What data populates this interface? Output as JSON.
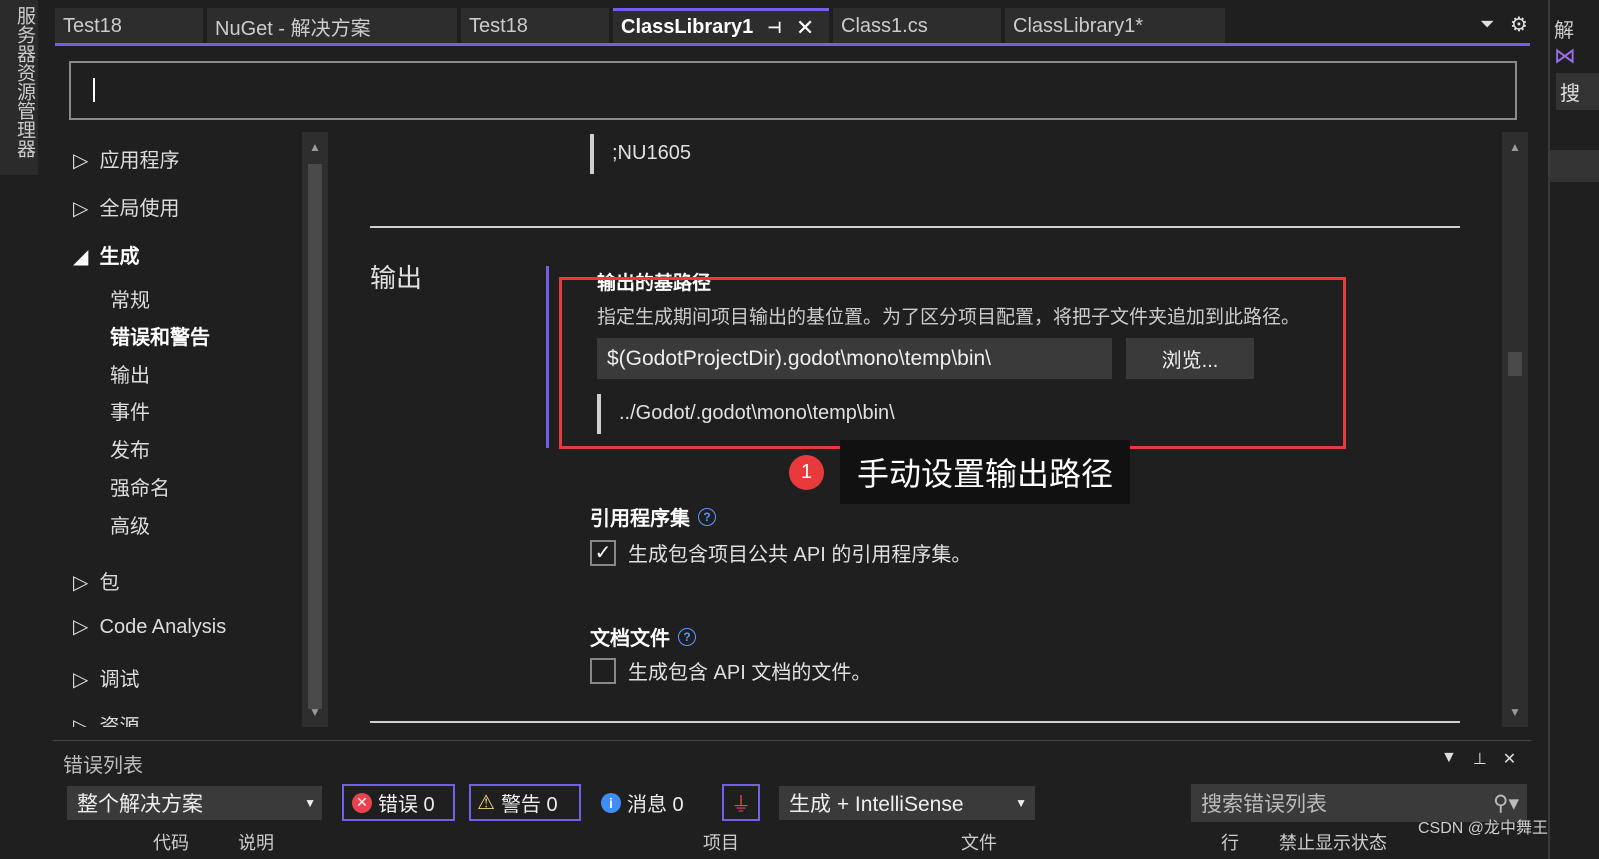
{
  "side_tab": "服务器资源管理器",
  "right_panel": {
    "title": "解",
    "search": "搜"
  },
  "tabs": [
    {
      "label": "Test18"
    },
    {
      "label": "NuGet - 解决方案"
    },
    {
      "label": "Test18"
    },
    {
      "label": "ClassLibrary1",
      "active": true
    },
    {
      "label": "Class1.cs"
    },
    {
      "label": "ClassLibrary1*"
    }
  ],
  "tab_icons": {
    "pin": "pin-icon",
    "close": "close-icon"
  },
  "search": {
    "value": ""
  },
  "nav": {
    "items": [
      {
        "label": "应用程序",
        "level": 0,
        "expanded": false
      },
      {
        "label": "全局使用",
        "level": 0,
        "expanded": false
      },
      {
        "label": "生成",
        "level": 0,
        "expanded": true
      },
      {
        "label": "常规",
        "level": 1
      },
      {
        "label": "错误和警告",
        "level": 1,
        "selected": true
      },
      {
        "label": "输出",
        "level": 1
      },
      {
        "label": "事件",
        "level": 1
      },
      {
        "label": "发布",
        "level": 1
      },
      {
        "label": "强命名",
        "level": 1
      },
      {
        "label": "高级",
        "level": 1
      },
      {
        "label": "包",
        "level": 0,
        "expanded": false
      },
      {
        "label": "Code Analysis",
        "level": 0,
        "expanded": false
      },
      {
        "label": "调试",
        "level": 0,
        "expanded": false
      },
      {
        "label": "资源",
        "level": 0,
        "expanded": false
      }
    ]
  },
  "main": {
    "prev_value": ";NU1605",
    "section_title": "输出",
    "base_path": {
      "label": "输出的基路径",
      "description": "指定生成期间项目输出的基位置。为了区分项目配置，将把子文件夹追加到此路径。",
      "value": "$(GodotProjectDir).godot\\mono\\temp\\bin\\",
      "browse": "浏览...",
      "evaluated": "../Godot/.godot\\mono\\temp\\bin\\"
    },
    "ref_assembly": {
      "label": "引用程序集",
      "checkbox": "生成包含项目公共 API 的引用程序集。",
      "checked": true
    },
    "doc_file": {
      "label": "文档文件",
      "checkbox": "生成包含 API 文档的文件。",
      "checked": false
    }
  },
  "annotation": {
    "number": "1",
    "text": "手动设置输出路径",
    "color": "#e83a3a"
  },
  "error_list": {
    "title": "错误列表",
    "scope": "整个解决方案",
    "errors": "错误 0",
    "warnings": "警告 0",
    "messages": "消息 0",
    "source": "生成 + IntelliSense",
    "search_placeholder": "搜索错误列表",
    "columns": [
      "代码",
      "说明",
      "项目",
      "文件",
      "行",
      "禁止显示状态"
    ]
  },
  "watermark": "CSDN @龙中舞王",
  "colors": {
    "accent": "#7160e8",
    "highlight": "#e83a3a"
  }
}
